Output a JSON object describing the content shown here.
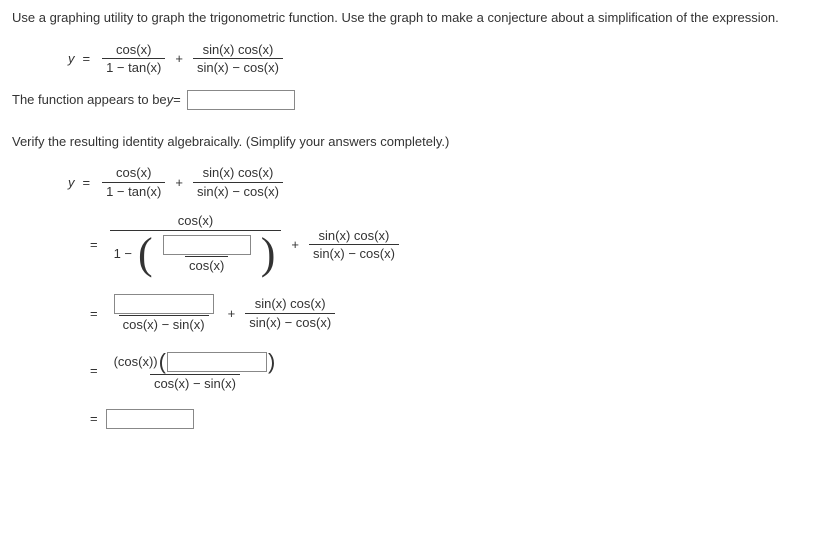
{
  "instructions": {
    "line1": "Use a graphing utility to graph the trigonometric function. Use the graph to make a conjecture about a simplification of the expression."
  },
  "eq1": {
    "lhs": "y",
    "frac1_num": "cos(x)",
    "frac1_den_a": "1 − tan(x)",
    "plus": "+",
    "frac2_num": "sin(x) cos(x)",
    "frac2_den": "sin(x) − cos(x)"
  },
  "appears": {
    "text_a": "The function appears to be ",
    "text_b": "y",
    "text_c": " ="
  },
  "verify": {
    "text": "Verify the resulting identity algebraically. (Simplify your answers completely.)"
  },
  "eq2": {
    "lhs": "y",
    "frac1_num": "cos(x)",
    "frac1_den": "1 − tan(x)",
    "plus": "+",
    "frac2_num": "sin(x) cos(x)",
    "frac2_den": "sin(x) − cos(x)"
  },
  "step1": {
    "outer_num": "cos(x)",
    "outer_den_left": "1 −",
    "inner_den": "cos(x)",
    "plus": "+",
    "frac2_num": "sin(x) cos(x)",
    "frac2_den": "sin(x) − cos(x)"
  },
  "step2": {
    "den": "cos(x) − sin(x)",
    "plus": "+",
    "frac2_num": "sin(x) cos(x)",
    "frac2_den": "sin(x) − cos(x)"
  },
  "step3": {
    "num_left": "(cos(x))",
    "den": "cos(x) − sin(x)"
  }
}
